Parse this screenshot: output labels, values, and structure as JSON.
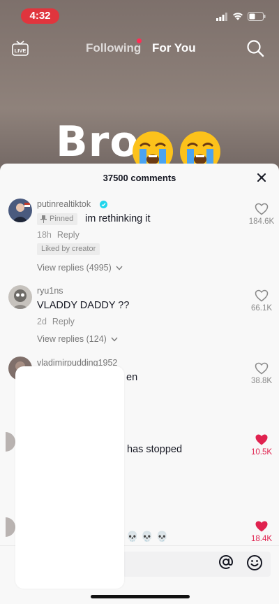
{
  "status_bar": {
    "time": "4:32"
  },
  "nav": {
    "live_label": "LIVE",
    "following": "Following",
    "for_you": "For You"
  },
  "video": {
    "overlay_text": "Bro",
    "emojis": [
      "😭",
      "😭"
    ]
  },
  "comments_sheet": {
    "count_label": "37500 comments",
    "comments": [
      {
        "username": "putinrealtiktok",
        "verified": true,
        "pinned_label": "Pinned",
        "text": "im rethinking it",
        "age": "18h",
        "reply_label": "Reply",
        "liked_by_creator": "Liked by creator",
        "view_replies": "View replies (4995)",
        "likes": "184.6K",
        "liked": false
      },
      {
        "username": "ryu1ns",
        "text": "VLADDY DADDY ??",
        "age": "2d",
        "reply_label": "Reply",
        "view_replies": "View replies (124)",
        "likes": "66.1K",
        "liked": false
      },
      {
        "username": "vladimirpudding1952",
        "text_fragment": "en",
        "likes": "38.8K",
        "liked": false
      },
      {
        "text_fragment": "has stopped",
        "likes": "10.5K",
        "liked": true
      },
      {
        "text_fragment": "💀💀💀",
        "likes": "18.4K",
        "liked": true
      }
    ]
  },
  "colors": {
    "accent_red": "#e0224f",
    "time_pill": "#e0353d"
  }
}
